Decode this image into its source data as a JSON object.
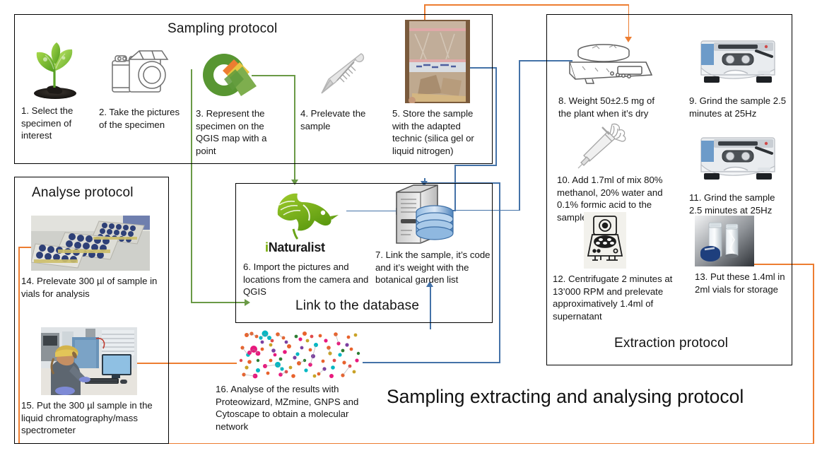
{
  "main_title": "Sampling extracting and analysing protocol",
  "sections": {
    "sampling": {
      "title": "Sampling protocol"
    },
    "extraction": {
      "title": "Extraction protocol"
    },
    "database": {
      "title": "Link to the database"
    },
    "analyse": {
      "title": "Analyse protocol"
    }
  },
  "steps": {
    "s1": {
      "caption": "1. Select the specimen of interest",
      "icon": "seedling-plant-icon"
    },
    "s2": {
      "caption": "2. Take the pictures of the specimen",
      "icon": "camera-icon"
    },
    "s3": {
      "caption": "3. Represent the specimen on the QGIS map with a point",
      "icon": "qgis-logo-icon"
    },
    "s4": {
      "caption": "4. Prelevate the sample",
      "icon": "scalpel-icon"
    },
    "s5": {
      "caption": "5. Store the sample with the adapted technic (silica gel or liquid nitrogen)",
      "icon": "sample-bag-photo"
    },
    "s6": {
      "caption": "6. Import the pictures and locations from the camera and QGIS",
      "icon": "inaturalist-logo-icon",
      "logo_text": "iNaturalist"
    },
    "s7": {
      "caption": "7. Link the sample, it’s code and it’s weight with the botanical garden list",
      "icon": "database-server-icon"
    },
    "s8": {
      "caption": "8. Weight 50±2.5 mg of the plant when it’s dry",
      "icon": "precision-balance-icon"
    },
    "s9": {
      "caption": "9. Grind the sample 2.5 minutes at 25Hz",
      "icon": "ball-mill-grinder-icon"
    },
    "s10": {
      "caption": "10. Add 1.7ml of mix 80% methanol, 20% water and 0.1% formic acid to the sample",
      "icon": "pipette-hand-icon"
    },
    "s11": {
      "caption": "11. Grind the sample 2.5 minutes at 25Hz",
      "icon": "ball-mill-grinder-icon"
    },
    "s12": {
      "caption": "12. Centrifugate 2 minutes at 13’000 RPM and prelevate approximatively 1.4ml of supernatant",
      "icon": "centrifuge-icon"
    },
    "s13": {
      "caption": "13. Put these 1.4ml in 2ml vials for storage",
      "icon": "glass-vials-photo"
    },
    "s14": {
      "caption": "14. Prelevate 300 µl of sample in vials for analysis",
      "icon": "vial-racks-photo"
    },
    "s15": {
      "caption": "15. Put the 300 µl sample in the liquid chromatography/mass spectrometer",
      "icon": "lcms-operator-photo"
    },
    "s16": {
      "caption": "16. Analyse of the results with Proteowizard, MZmine, GNPS and Cytoscape to obtain a molecular network",
      "icon": "molecular-network-photo"
    }
  },
  "colors": {
    "blue": "#4472a8",
    "green": "#6a9a46",
    "orange": "#ED7D31",
    "outline": "#000000",
    "qgis_green": "#589632",
    "qgis_orange": "#ED7D31",
    "inat_green": "#74AC00"
  }
}
